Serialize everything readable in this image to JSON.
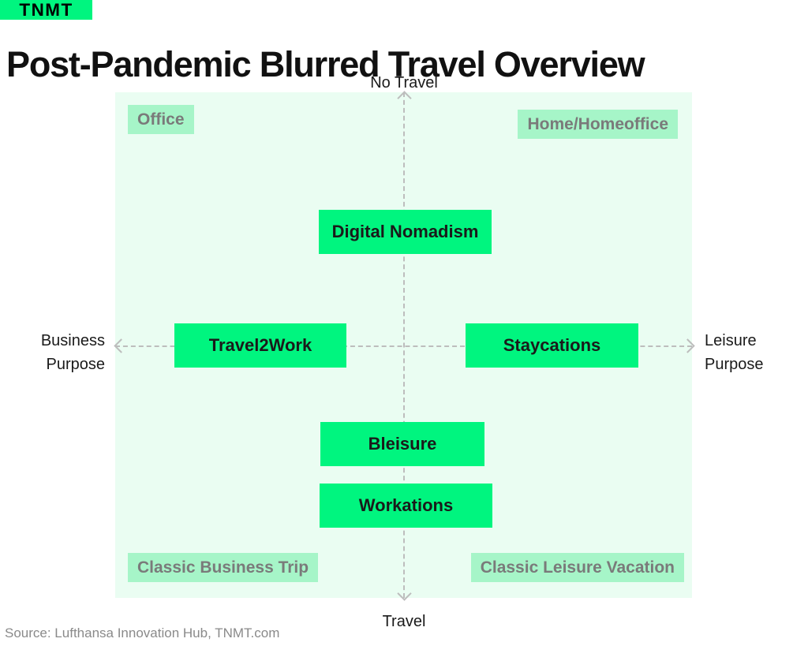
{
  "header": {
    "logo_text": "TNMT",
    "logo_bg": "#00F57F",
    "title": "Post-Pandemic Blurred Travel Overview"
  },
  "axes": {
    "top_label": "No Travel",
    "bottom_label": "Travel",
    "left_label": "Business\nPurpose",
    "right_label": "Leisure\nPurpose"
  },
  "corner_tags": [
    {
      "id": "office",
      "label": "Office"
    },
    {
      "id": "home-homeoffice",
      "label": "Home/Homeoffice"
    },
    {
      "id": "classic-business-trip",
      "label": "Classic Business Trip"
    },
    {
      "id": "classic-leisure-vacation",
      "label": "Classic Leisure Vacation"
    }
  ],
  "concepts": [
    {
      "id": "digital-nomadism",
      "label": "Digital Nomadism"
    },
    {
      "id": "travel2work",
      "label": "Travel2Work"
    },
    {
      "id": "staycations",
      "label": "Staycations"
    },
    {
      "id": "bleisure",
      "label": "Bleisure"
    },
    {
      "id": "workations",
      "label": "Workations"
    }
  ],
  "footer": {
    "source": "Source: Lufthansa Innovation Hub, TNMT.com"
  },
  "colors": {
    "brand_green": "#00F57F",
    "panel_bg": "#EAFDF2",
    "tag_bg": "#A6F5C8",
    "tag_text": "#7A7A7A",
    "axis_dash": "#BDBDBD",
    "source_text": "#8A8A8A"
  },
  "chart_data": {
    "type": "scatter",
    "title": "Post-Pandemic Blurred Travel Overview",
    "xlabel": "Business Purpose ↔ Leisure Purpose",
    "ylabel": "Travel ↔ No Travel",
    "xlim": [
      -1,
      1
    ],
    "ylim": [
      -1,
      1
    ],
    "grid": false,
    "axis_tick_labels": {
      "x_left": "Business Purpose",
      "x_right": "Leisure Purpose",
      "y_top": "No Travel",
      "y_bottom": "Travel"
    },
    "quadrant_labels": [
      {
        "label": "Office",
        "x": -0.88,
        "y": 0.92,
        "style": "muted"
      },
      {
        "label": "Home/Homeoffice",
        "x": 0.7,
        "y": 0.9,
        "style": "muted"
      },
      {
        "label": "Classic Business Trip",
        "x": -0.7,
        "y": -0.9,
        "style": "muted"
      },
      {
        "label": "Classic Leisure Vacation",
        "x": 0.66,
        "y": -0.9,
        "style": "muted"
      }
    ],
    "points": [
      {
        "label": "Digital Nomadism",
        "x": 0.0,
        "y": 0.46,
        "style": "highlight"
      },
      {
        "label": "Travel2Work",
        "x": -0.5,
        "y": 0.01,
        "style": "highlight"
      },
      {
        "label": "Staycations",
        "x": 0.51,
        "y": 0.01,
        "style": "highlight"
      },
      {
        "label": "Bleisure",
        "x": -0.01,
        "y": -0.39,
        "style": "highlight"
      },
      {
        "label": "Workations",
        "x": 0.0,
        "y": -0.63,
        "style": "highlight"
      }
    ],
    "legend": null,
    "annotations": [
      "Source: Lufthansa Innovation Hub, TNMT.com"
    ]
  }
}
